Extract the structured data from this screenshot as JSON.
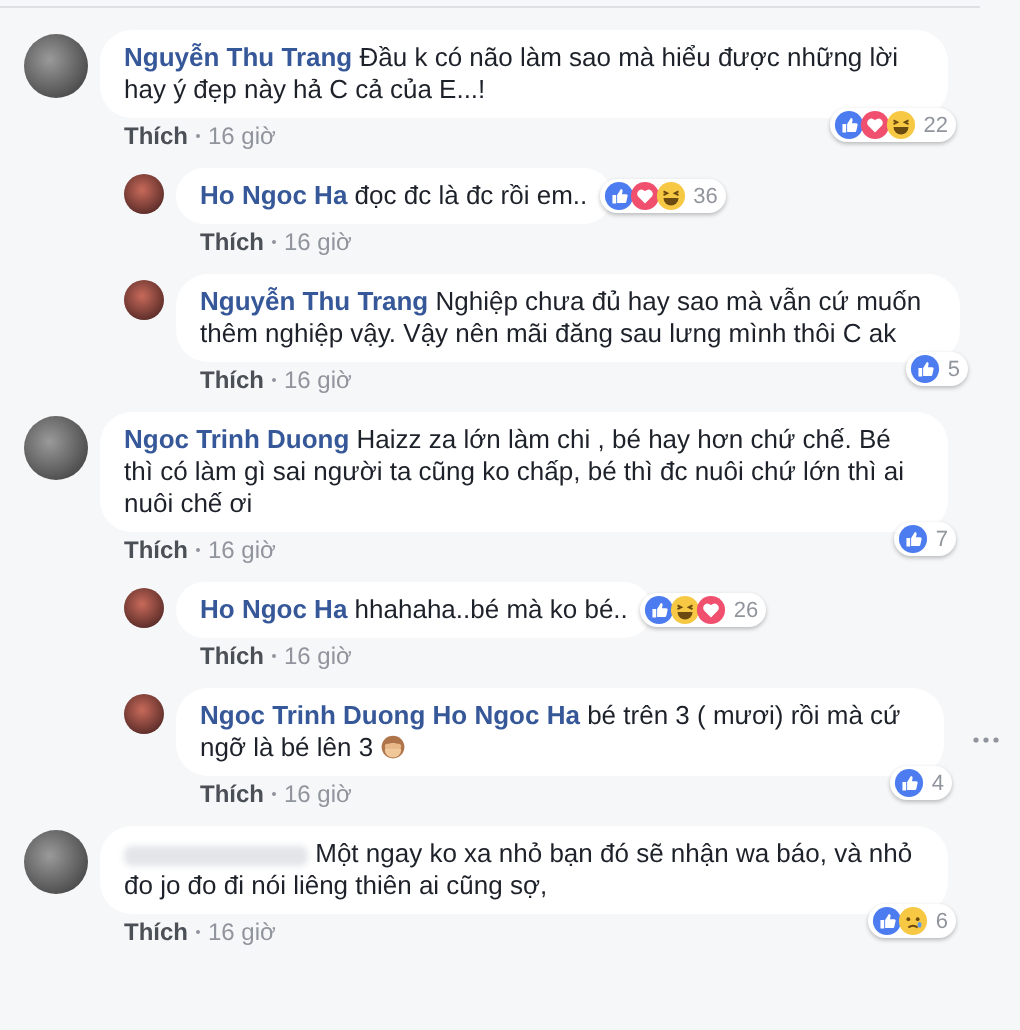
{
  "comments": [
    {
      "name": "Nguyễn Thu Trang",
      "text": "Đầu k có não làm sao mà hiểu được những lời hay ý đẹp này hả C cả của E...!",
      "reactions": [
        {
          "kind": "like"
        },
        {
          "kind": "love"
        },
        {
          "kind": "haha"
        }
      ],
      "reaction_count": "22",
      "badge_inline": false,
      "action": "Thích",
      "time": "16 giờ",
      "replies": [
        {
          "name": "Ho Ngoc Ha",
          "text": "đọc đc là đc rồi em..",
          "reactions": [
            {
              "kind": "like"
            },
            {
              "kind": "love"
            },
            {
              "kind": "haha"
            }
          ],
          "reaction_count": "36",
          "badge_inline": true,
          "action": "Thích",
          "time": "16 giờ"
        },
        {
          "name": "Nguyễn Thu Trang",
          "text": "Nghiệp chưa đủ hay sao mà vẫn cứ muốn thêm nghiệp vậy. Vậy nên mãi đăng sau lưng mình thôi C ak",
          "reactions": [
            {
              "kind": "like"
            }
          ],
          "reaction_count": "5",
          "badge_inline": false,
          "action": "Thích",
          "time": "16 giờ"
        }
      ]
    },
    {
      "name": "Ngoc Trinh Duong",
      "text": "Haizz za lớn làm chi , bé hay hơn chứ chế. Bé thì có làm gì sai người ta cũng ko chấp, bé thì đc nuôi chứ lớn thì ai nuôi chế ơi",
      "reactions": [
        {
          "kind": "like"
        }
      ],
      "reaction_count": "7",
      "badge_inline": false,
      "action": "Thích",
      "time": "16 giờ",
      "replies": [
        {
          "name": "Ho Ngoc Ha",
          "text": "hhahaha..bé mà ko bé..",
          "reactions": [
            {
              "kind": "like"
            },
            {
              "kind": "haha"
            },
            {
              "kind": "love"
            }
          ],
          "reaction_count": "26",
          "badge_inline": true,
          "action": "Thích",
          "time": "16 giờ"
        },
        {
          "name": "Ngoc Trinh Duong",
          "mention": "Ho Ngoc Ha",
          "text": "bé trên 3 ( mươi) rồi mà cứ ngỡ là bé lên 3",
          "trailing_emoji": true,
          "options": true,
          "reactions": [
            {
              "kind": "like"
            }
          ],
          "reaction_count": "4",
          "badge_inline": false,
          "action": "Thích",
          "time": "16 giờ"
        }
      ]
    },
    {
      "name_hidden": true,
      "text": "Một ngay ko xa nhỏ bạn đó sẽ nhận wa báo, và nhỏ đo jo đo đi nói liêng thiên ai cũng sợ,",
      "reactions": [
        {
          "kind": "like"
        },
        {
          "kind": "sad"
        }
      ],
      "reaction_count": "6",
      "badge_inline": false,
      "action": "Thích",
      "time": "16 giờ"
    }
  ]
}
